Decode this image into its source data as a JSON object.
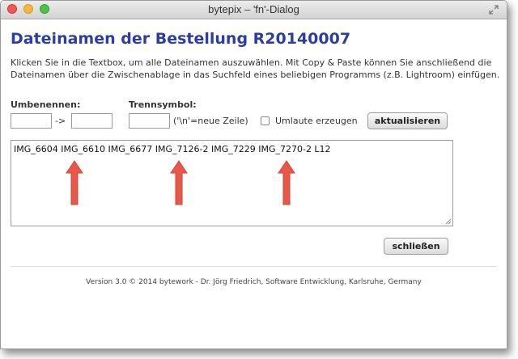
{
  "window": {
    "title": "bytepix – 'fn'-Dialog"
  },
  "dialog": {
    "heading": "Dateinamen der Bestellung R20140007",
    "description": "Klicken Sie in die Textbox, um alle Dateinamen auszuwählen. Mit Copy & Paste können Sie anschließend die Dateinamen über die Zwischenablage in das Suchfeld eines beliebigen Programms (z.B. Lightroom) einfügen.",
    "rename_label": "Umbenennen:",
    "rename_from_value": "",
    "rename_arrow": "->",
    "rename_to_value": "",
    "separator_label": "Trennsymbol:",
    "separator_value": "",
    "separator_hint": "('\\n'=neue Zeile)",
    "umlaut_label": "Umlaute erzeugen",
    "umlaut_checked": false,
    "update_button": "aktualisieren",
    "filenames": "IMG_6604 IMG_6610 IMG_6677 IMG_7126-2 IMG_7229 IMG_7270-2 L12",
    "close_button": "schließen",
    "footer": "Version 3.0 © 2014 bytework - Dr. Jörg Friedrich, Software Entwicklung, Karlsruhe, Germany"
  },
  "annotations": {
    "arrow_color": "#e8584a",
    "arrow_count": 3
  },
  "colors": {
    "heading": "#2c3e9e",
    "close": "#f2564f",
    "minimize": "#f3b83c",
    "maximize": "#4ec243"
  }
}
